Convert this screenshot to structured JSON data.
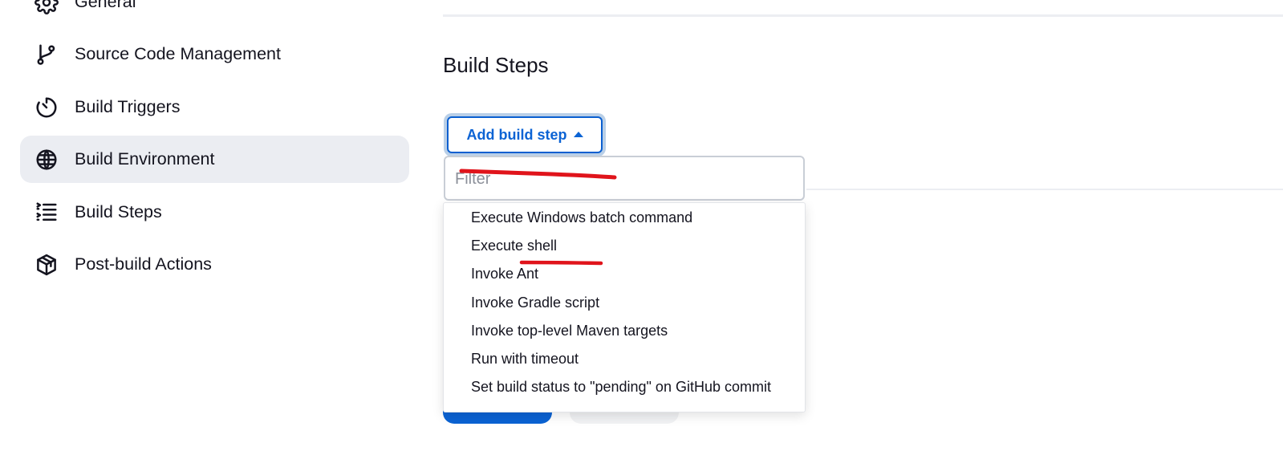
{
  "sidebar": {
    "items": [
      {
        "label": "General",
        "icon": "gear-icon",
        "active": false
      },
      {
        "label": "Source Code Management",
        "icon": "branch-icon",
        "active": false
      },
      {
        "label": "Build Triggers",
        "icon": "timer-icon",
        "active": false
      },
      {
        "label": "Build Environment",
        "icon": "globe-icon",
        "active": true
      },
      {
        "label": "Build Steps",
        "icon": "list-icon",
        "active": false
      },
      {
        "label": "Post-build Actions",
        "icon": "package-icon",
        "active": false
      }
    ]
  },
  "main": {
    "section_title": "Build Steps",
    "add_step_button": "Add build step",
    "filter_placeholder": "Filter",
    "menu": [
      "Execute Windows batch command",
      "Execute shell",
      "Invoke Ant",
      "Invoke Gradle script",
      "Invoke top-level Maven targets",
      "Run with timeout",
      "Set build status to \"pending\" on GitHub commit"
    ]
  },
  "colors": {
    "accent": "#0b63d4",
    "annotation": "#e0141b",
    "active_nav": "#ebedf2"
  }
}
